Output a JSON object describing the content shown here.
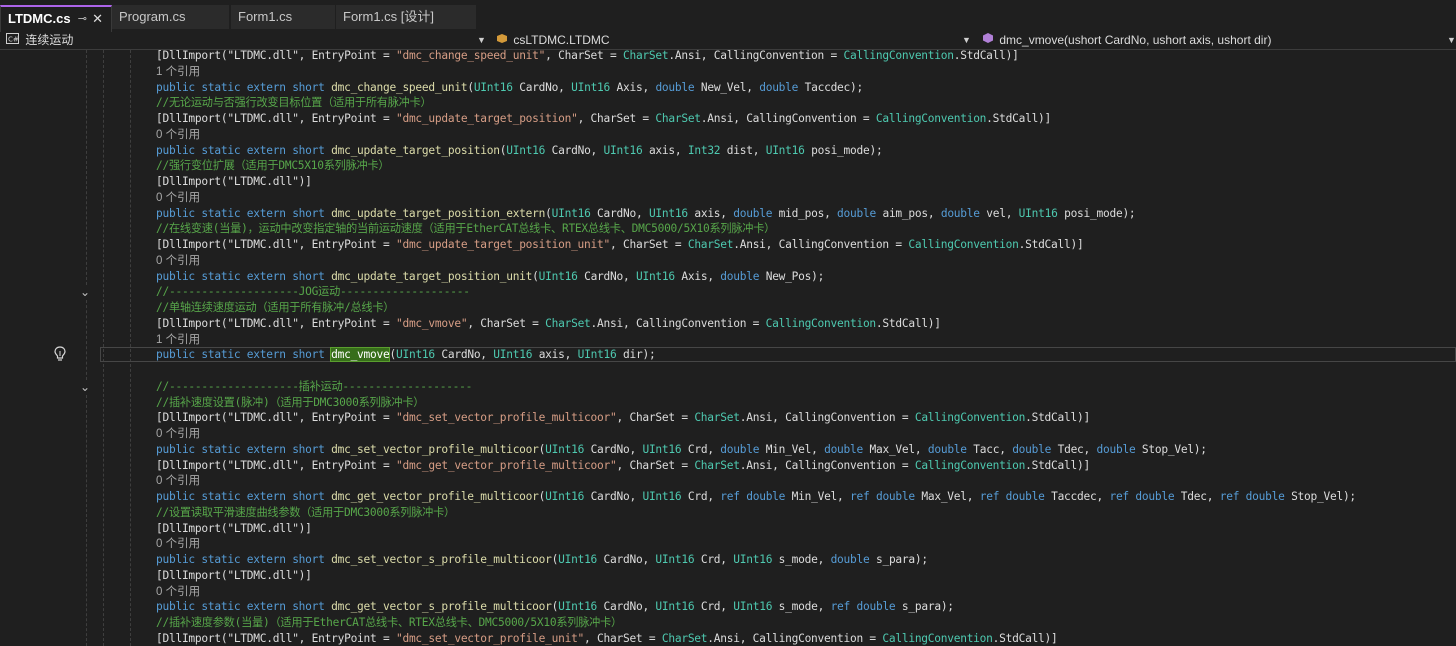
{
  "tabs": [
    {
      "label": "LTDMC.cs",
      "active": true
    },
    {
      "label": "Program.cs",
      "active": false
    },
    {
      "label": "Form1.cs",
      "active": false
    },
    {
      "label": "Form1.cs [设计]",
      "active": false
    }
  ],
  "nav": {
    "project": "连续运动",
    "class": "csLTDMC.LTDMC",
    "member": "dmc_vmove(ushort CardNo, ushort axis, ushort dir)"
  },
  "colors": {
    "keyword": "#569cd6",
    "type": "#4ec9b0",
    "function": "#dcdcaa",
    "string": "#d69d85",
    "comment": "#57a64a",
    "highlight": "#376e1a"
  },
  "icons": [
    "pin-icon",
    "close-icon",
    "project-icon",
    "class-icon",
    "method-icon",
    "chevron-down-icon",
    "lightbulb-icon"
  ],
  "code_lines": [
    [
      [
        "pr",
        "[DllImport(\"LTDMC.dll\", EntryPoint = "
      ],
      [
        "str",
        "\"dmc_change_speed_unit\""
      ],
      [
        "pr",
        ", CharSet = "
      ],
      [
        "cl",
        "CharSet"
      ],
      [
        "pr",
        ".Ansi, CallingConvention = "
      ],
      [
        "cl",
        "CallingConvention"
      ],
      [
        "pr",
        ".StdCall)]"
      ]
    ],
    [
      [
        "ref",
        "1 个引用"
      ]
    ],
    [
      [
        "kw",
        "public static extern short "
      ],
      [
        "fn",
        "dmc_change_speed_unit"
      ],
      [
        "pr",
        "("
      ],
      [
        "ty",
        "UInt16"
      ],
      [
        "pr",
        " CardNo, "
      ],
      [
        "ty",
        "UInt16"
      ],
      [
        "pr",
        " Axis, "
      ],
      [
        "kw",
        "double"
      ],
      [
        "pr",
        " New_Vel, "
      ],
      [
        "kw",
        "double"
      ],
      [
        "pr",
        " Taccdec);"
      ]
    ],
    [
      [
        "cm",
        "//无论运动与否强行改变目标位置（适用于所有脉冲卡）"
      ]
    ],
    [
      [
        "pr",
        "[DllImport(\"LTDMC.dll\", EntryPoint = "
      ],
      [
        "str",
        "\"dmc_update_target_position\""
      ],
      [
        "pr",
        ", CharSet = "
      ],
      [
        "cl",
        "CharSet"
      ],
      [
        "pr",
        ".Ansi, CallingConvention = "
      ],
      [
        "cl",
        "CallingConvention"
      ],
      [
        "pr",
        ".StdCall)]"
      ]
    ],
    [
      [
        "ref",
        "0 个引用"
      ]
    ],
    [
      [
        "kw",
        "public static extern short "
      ],
      [
        "fn",
        "dmc_update_target_position"
      ],
      [
        "pr",
        "("
      ],
      [
        "ty",
        "UInt16"
      ],
      [
        "pr",
        " CardNo, "
      ],
      [
        "ty",
        "UInt16"
      ],
      [
        "pr",
        " axis, "
      ],
      [
        "ty",
        "Int32"
      ],
      [
        "pr",
        " dist, "
      ],
      [
        "ty",
        "UInt16"
      ],
      [
        "pr",
        " posi_mode);"
      ]
    ],
    [
      [
        "cm",
        "//强行变位扩展（适用于DMC5X10系列脉冲卡）"
      ]
    ],
    [
      [
        "pr",
        "[DllImport(\"LTDMC.dll\")]"
      ]
    ],
    [
      [
        "ref",
        "0 个引用"
      ]
    ],
    [
      [
        "kw",
        "public static extern short "
      ],
      [
        "fn",
        "dmc_update_target_position_extern"
      ],
      [
        "pr",
        "("
      ],
      [
        "ty",
        "UInt16"
      ],
      [
        "pr",
        " CardNo, "
      ],
      [
        "ty",
        "UInt16"
      ],
      [
        "pr",
        " axis, "
      ],
      [
        "kw",
        "double"
      ],
      [
        "pr",
        " mid_pos, "
      ],
      [
        "kw",
        "double"
      ],
      [
        "pr",
        " aim_pos, "
      ],
      [
        "kw",
        "double"
      ],
      [
        "pr",
        " vel, "
      ],
      [
        "ty",
        "UInt16"
      ],
      [
        "pr",
        " posi_mode);"
      ]
    ],
    [
      [
        "cm",
        "//在线变速(当量)，运动中改变指定轴的当前运动速度（适用于EtherCAT总线卡、RTEX总线卡、DMC5000/5X10系列脉冲卡）"
      ]
    ],
    [
      [
        "pr",
        "[DllImport(\"LTDMC.dll\", EntryPoint = "
      ],
      [
        "str",
        "\"dmc_update_target_position_unit\""
      ],
      [
        "pr",
        ", CharSet = "
      ],
      [
        "cl",
        "CharSet"
      ],
      [
        "pr",
        ".Ansi, CallingConvention = "
      ],
      [
        "cl",
        "CallingConvention"
      ],
      [
        "pr",
        ".StdCall)]"
      ]
    ],
    [
      [
        "ref",
        "0 个引用"
      ]
    ],
    [
      [
        "kw",
        "public static extern short "
      ],
      [
        "fn",
        "dmc_update_target_position_unit"
      ],
      [
        "pr",
        "("
      ],
      [
        "ty",
        "UInt16"
      ],
      [
        "pr",
        " CardNo, "
      ],
      [
        "ty",
        "UInt16"
      ],
      [
        "pr",
        " Axis, "
      ],
      [
        "kw",
        "double"
      ],
      [
        "pr",
        " New_Pos);"
      ]
    ],
    [
      [
        "cm",
        "//--------------------JOG运动--------------------"
      ]
    ],
    [
      [
        "cm",
        "//单轴连续速度运动（适用于所有脉冲/总线卡）"
      ]
    ],
    [
      [
        "pr",
        "[DllImport(\"LTDMC.dll\", EntryPoint = "
      ],
      [
        "str",
        "\"dmc_vmove\""
      ],
      [
        "pr",
        ", CharSet = "
      ],
      [
        "cl",
        "CharSet"
      ],
      [
        "pr",
        ".Ansi, CallingConvention = "
      ],
      [
        "cl",
        "CallingConvention"
      ],
      [
        "pr",
        ".StdCall)]"
      ]
    ],
    [
      [
        "ref",
        "1 个引用"
      ]
    ],
    [
      [
        "kw",
        "public static extern short "
      ],
      [
        "hl",
        "dmc_vmove"
      ],
      [
        "pr",
        "("
      ],
      [
        "ty",
        "UInt16"
      ],
      [
        "pr",
        " CardNo, "
      ],
      [
        "ty",
        "UInt16"
      ],
      [
        "pr",
        " axis, "
      ],
      [
        "ty",
        "UInt16"
      ],
      [
        "pr",
        " dir);"
      ]
    ],
    [],
    [
      [
        "cm",
        "//--------------------插补运动--------------------"
      ]
    ],
    [
      [
        "cm",
        "//插补速度设置(脉冲)（适用于DMC3000系列脉冲卡）"
      ]
    ],
    [
      [
        "pr",
        "[DllImport(\"LTDMC.dll\", EntryPoint = "
      ],
      [
        "str",
        "\"dmc_set_vector_profile_multicoor\""
      ],
      [
        "pr",
        ", CharSet = "
      ],
      [
        "cl",
        "CharSet"
      ],
      [
        "pr",
        ".Ansi, CallingConvention = "
      ],
      [
        "cl",
        "CallingConvention"
      ],
      [
        "pr",
        ".StdCall)]"
      ]
    ],
    [
      [
        "ref",
        "0 个引用"
      ]
    ],
    [
      [
        "kw",
        "public static extern short "
      ],
      [
        "fn",
        "dmc_set_vector_profile_multicoor"
      ],
      [
        "pr",
        "("
      ],
      [
        "ty",
        "UInt16"
      ],
      [
        "pr",
        " CardNo, "
      ],
      [
        "ty",
        "UInt16"
      ],
      [
        "pr",
        " Crd, "
      ],
      [
        "kw",
        "double"
      ],
      [
        "pr",
        " Min_Vel, "
      ],
      [
        "kw",
        "double"
      ],
      [
        "pr",
        " Max_Vel, "
      ],
      [
        "kw",
        "double"
      ],
      [
        "pr",
        " Tacc, "
      ],
      [
        "kw",
        "double"
      ],
      [
        "pr",
        " Tdec, "
      ],
      [
        "kw",
        "double"
      ],
      [
        "pr",
        " Stop_Vel);"
      ]
    ],
    [
      [
        "pr",
        "[DllImport(\"LTDMC.dll\", EntryPoint = "
      ],
      [
        "str",
        "\"dmc_get_vector_profile_multicoor\""
      ],
      [
        "pr",
        ", CharSet = "
      ],
      [
        "cl",
        "CharSet"
      ],
      [
        "pr",
        ".Ansi, CallingConvention = "
      ],
      [
        "cl",
        "CallingConvention"
      ],
      [
        "pr",
        ".StdCall)]"
      ]
    ],
    [
      [
        "ref",
        "0 个引用"
      ]
    ],
    [
      [
        "kw",
        "public static extern short "
      ],
      [
        "fn",
        "dmc_get_vector_profile_multicoor"
      ],
      [
        "pr",
        "("
      ],
      [
        "ty",
        "UInt16"
      ],
      [
        "pr",
        " CardNo, "
      ],
      [
        "ty",
        "UInt16"
      ],
      [
        "pr",
        " Crd, "
      ],
      [
        "kw",
        "ref double"
      ],
      [
        "pr",
        " Min_Vel, "
      ],
      [
        "kw",
        "ref double"
      ],
      [
        "pr",
        " Max_Vel, "
      ],
      [
        "kw",
        "ref double"
      ],
      [
        "pr",
        " Taccdec, "
      ],
      [
        "kw",
        "ref double"
      ],
      [
        "pr",
        " Tdec, "
      ],
      [
        "kw",
        "ref double"
      ],
      [
        "pr",
        " Stop_Vel);"
      ]
    ],
    [
      [
        "cm",
        "//设置读取平滑速度曲线参数（适用于DMC3000系列脉冲卡）"
      ]
    ],
    [
      [
        "pr",
        "[DllImport(\"LTDMC.dll\")]"
      ]
    ],
    [
      [
        "ref",
        "0 个引用"
      ]
    ],
    [
      [
        "kw",
        "public static extern short "
      ],
      [
        "fn",
        "dmc_set_vector_s_profile_multicoor"
      ],
      [
        "pr",
        "("
      ],
      [
        "ty",
        "UInt16"
      ],
      [
        "pr",
        " CardNo, "
      ],
      [
        "ty",
        "UInt16"
      ],
      [
        "pr",
        " Crd, "
      ],
      [
        "ty",
        "UInt16"
      ],
      [
        "pr",
        " s_mode, "
      ],
      [
        "kw",
        "double"
      ],
      [
        "pr",
        " s_para);"
      ]
    ],
    [
      [
        "pr",
        "[DllImport(\"LTDMC.dll\")]"
      ]
    ],
    [
      [
        "ref",
        "0 个引用"
      ]
    ],
    [
      [
        "kw",
        "public static extern short "
      ],
      [
        "fn",
        "dmc_get_vector_s_profile_multicoor"
      ],
      [
        "pr",
        "("
      ],
      [
        "ty",
        "UInt16"
      ],
      [
        "pr",
        " CardNo, "
      ],
      [
        "ty",
        "UInt16"
      ],
      [
        "pr",
        " Crd, "
      ],
      [
        "ty",
        "UInt16"
      ],
      [
        "pr",
        " s_mode, "
      ],
      [
        "kw",
        "ref double"
      ],
      [
        "pr",
        " s_para);"
      ]
    ],
    [
      [
        "cm",
        "//插补速度参数(当量)（适用于EtherCAT总线卡、RTEX总线卡、DMC5000/5X10系列脉冲卡）"
      ]
    ],
    [
      [
        "pr",
        "[DllImport(\"LTDMC.dll\", EntryPoint = "
      ],
      [
        "str",
        "\"dmc_set_vector_profile_unit\""
      ],
      [
        "pr",
        ", CharSet = "
      ],
      [
        "cl",
        "CharSet"
      ],
      [
        "pr",
        ".Ansi, CallingConvention = "
      ],
      [
        "cl",
        "CallingConvention"
      ],
      [
        "pr",
        ".StdCall)]"
      ]
    ]
  ]
}
